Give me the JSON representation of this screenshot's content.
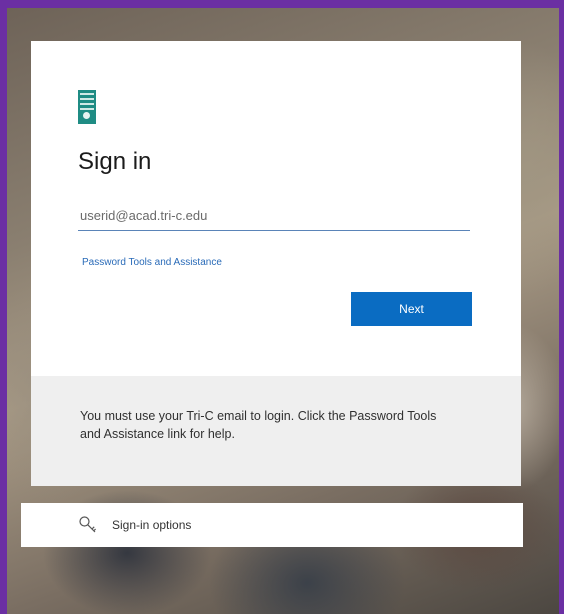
{
  "signin": {
    "title": "Sign in",
    "email_placeholder": "userid@acad.tri-c.edu",
    "email_value": "",
    "password_link": "Password Tools and Assistance",
    "next_label": "Next",
    "footer_message": "You must use your Tri-C email to login. Click the Password Tools and Assistance link for help."
  },
  "options": {
    "label": "Sign-in options",
    "icon": "key-icon"
  },
  "colors": {
    "accent": "#0a6cc2",
    "link": "#2a6bb8",
    "border_purple": "#6b2fa3",
    "logo_teal": "#1f8c84"
  }
}
